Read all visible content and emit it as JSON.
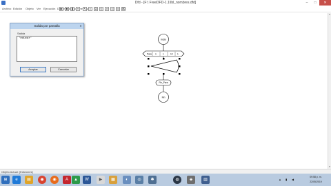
{
  "window": {
    "title": "Dfd - [F:\\ FreeDFD-1.1\\lbl_nombres.dfd]",
    "min_glyph": "–",
    "max_glyph": "□",
    "close_glyph": "✕"
  },
  "menu": {
    "items": [
      "Archivo",
      "Edición",
      "Objeto",
      "Ver",
      "Ejecución",
      "Depuración",
      "Opciones",
      "Ayuda"
    ]
  },
  "toolbar": {
    "buttons": [
      {
        "name": "run-button",
        "glyph": "▶"
      },
      {
        "name": "stop-button",
        "glyph": "■"
      },
      {
        "name": "pause-button",
        "glyph": "❚"
      },
      {
        "name": "step-button",
        "glyph": "»"
      },
      {
        "name": "cursor-button",
        "glyph": "↖"
      },
      {
        "name": "start-shape-button",
        "glyph": "○"
      },
      {
        "name": "cycle-shape-button",
        "glyph": "⬭"
      },
      {
        "name": "decision-shape-button",
        "glyph": "◇"
      },
      {
        "name": "read-shape-button",
        "glyph": "▱"
      },
      {
        "name": "write-shape-button",
        "glyph": "◁"
      },
      {
        "name": "assign-shape-button",
        "glyph": "▭"
      },
      {
        "name": "subprogram-button",
        "glyph": "⌧"
      }
    ]
  },
  "flowchart": {
    "start_label": "Inicio",
    "loop_label": "Para  ·  ·  ·  ·",
    "loop_parts": [
      "Para",
      "n",
      "1",
      "10",
      "1"
    ],
    "output_label": "",
    "end_loop_label": "Fin_Para",
    "end_label": "Fin"
  },
  "dialog": {
    "title": "Salida por pantalla",
    "close_glyph": "✕",
    "field_label": "Salida",
    "field_value": "'educar'",
    "ok_label": "Aceptar",
    "cancel_label": "Cancelar"
  },
  "status": {
    "text": "Objeto Actual: [Ediciones]"
  },
  "taskbar": {
    "apps": [
      {
        "name": "start-icon",
        "glyph": "⊞",
        "color": "#2f6fbd"
      },
      {
        "name": "ie-icon",
        "glyph": "e",
        "color": "#1f7ad8"
      },
      {
        "name": "explorer-icon",
        "glyph": "▤",
        "color": "#e0a52a"
      },
      {
        "name": "chrome-icon",
        "glyph": "◉",
        "color": "#d9432f"
      },
      {
        "name": "firefox-icon",
        "glyph": "◉",
        "color": "#e86b1c"
      },
      {
        "name": "pdf-icon",
        "glyph": "A",
        "color": "#c4262e"
      },
      {
        "name": "greenapp-icon",
        "glyph": "▲",
        "color": "#2c9a4a"
      },
      {
        "name": "word-icon",
        "glyph": "W",
        "color": "#2b5797"
      },
      {
        "name": "media-icon",
        "glyph": "▶",
        "color": "#d8d8d8"
      },
      {
        "name": "folder-icon",
        "glyph": "▦",
        "color": "#d8a03c"
      },
      {
        "name": "app-icon-a",
        "glyph": "◐",
        "color": "#6a8fbf"
      },
      {
        "name": "app-icon-b",
        "glyph": "◎",
        "color": "#5a7fa6"
      },
      {
        "name": "app-icon-c",
        "glyph": "✱",
        "color": "#4f6f92"
      },
      {
        "name": "steam-icon",
        "glyph": "◍",
        "color": "#2a3646"
      },
      {
        "name": "app-icon-d",
        "glyph": "◈",
        "color": "#6e6e6e"
      },
      {
        "name": "dfd-icon",
        "glyph": "▥",
        "color": "#3f5f8f"
      }
    ],
    "clock_time": "09:58 p. m.",
    "clock_date": "22/05/2019",
    "colors": {
      "bar": "#b9cbe0"
    }
  }
}
